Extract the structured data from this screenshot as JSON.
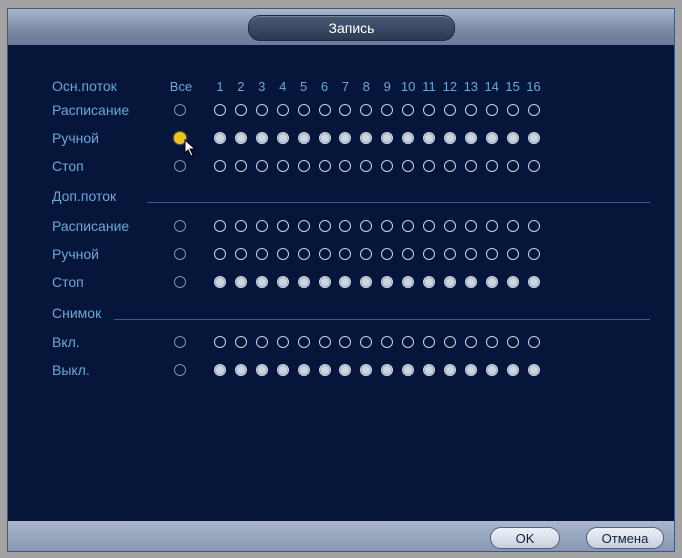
{
  "window": {
    "title": "Запись"
  },
  "header": {
    "stream_label": "Осн.поток",
    "all_label": "Все",
    "channels": [
      "1",
      "2",
      "3",
      "4",
      "5",
      "6",
      "7",
      "8",
      "9",
      "10",
      "11",
      "12",
      "13",
      "14",
      "15",
      "16"
    ]
  },
  "main_stream": {
    "rows": [
      {
        "label": "Расписание",
        "all": "off",
        "channels": [
          "off",
          "off",
          "off",
          "off",
          "off",
          "off",
          "off",
          "off",
          "off",
          "off",
          "off",
          "off",
          "off",
          "off",
          "off",
          "off"
        ]
      },
      {
        "label": "Ручной",
        "all": "sel",
        "channels": [
          "on",
          "on",
          "on",
          "on",
          "on",
          "on",
          "on",
          "on",
          "on",
          "on",
          "on",
          "on",
          "on",
          "on",
          "on",
          "on"
        ]
      },
      {
        "label": "Стоп",
        "all": "off",
        "channels": [
          "off",
          "off",
          "off",
          "off",
          "off",
          "off",
          "off",
          "off",
          "off",
          "off",
          "off",
          "off",
          "off",
          "off",
          "off",
          "off"
        ]
      }
    ]
  },
  "extra_stream": {
    "title": "Доп.поток",
    "rows": [
      {
        "label": "Расписание",
        "all": "off",
        "channels": [
          "off",
          "off",
          "off",
          "off",
          "off",
          "off",
          "off",
          "off",
          "off",
          "off",
          "off",
          "off",
          "off",
          "off",
          "off",
          "off"
        ]
      },
      {
        "label": "Ручной",
        "all": "off",
        "channels": [
          "off",
          "off",
          "off",
          "off",
          "off",
          "off",
          "off",
          "off",
          "off",
          "off",
          "off",
          "off",
          "off",
          "off",
          "off",
          "off"
        ]
      },
      {
        "label": "Стоп",
        "all": "off",
        "channels": [
          "on",
          "on",
          "on",
          "on",
          "on",
          "on",
          "on",
          "on",
          "on",
          "on",
          "on",
          "on",
          "on",
          "on",
          "on",
          "on"
        ]
      }
    ]
  },
  "snapshot": {
    "title": "Снимок",
    "rows": [
      {
        "label": "Вкл.",
        "all": "off",
        "channels": [
          "off",
          "off",
          "off",
          "off",
          "off",
          "off",
          "off",
          "off",
          "off",
          "off",
          "off",
          "off",
          "off",
          "off",
          "off",
          "off"
        ]
      },
      {
        "label": "Выкл.",
        "all": "off",
        "channels": [
          "on",
          "on",
          "on",
          "on",
          "on",
          "on",
          "on",
          "on",
          "on",
          "on",
          "on",
          "on",
          "on",
          "on",
          "on",
          "on"
        ]
      }
    ]
  },
  "buttons": {
    "ok": "OK",
    "cancel": "Отмена"
  },
  "colors": {
    "label": "#6aa8d8",
    "background": "#06153a",
    "selected": "#f2c31a"
  }
}
